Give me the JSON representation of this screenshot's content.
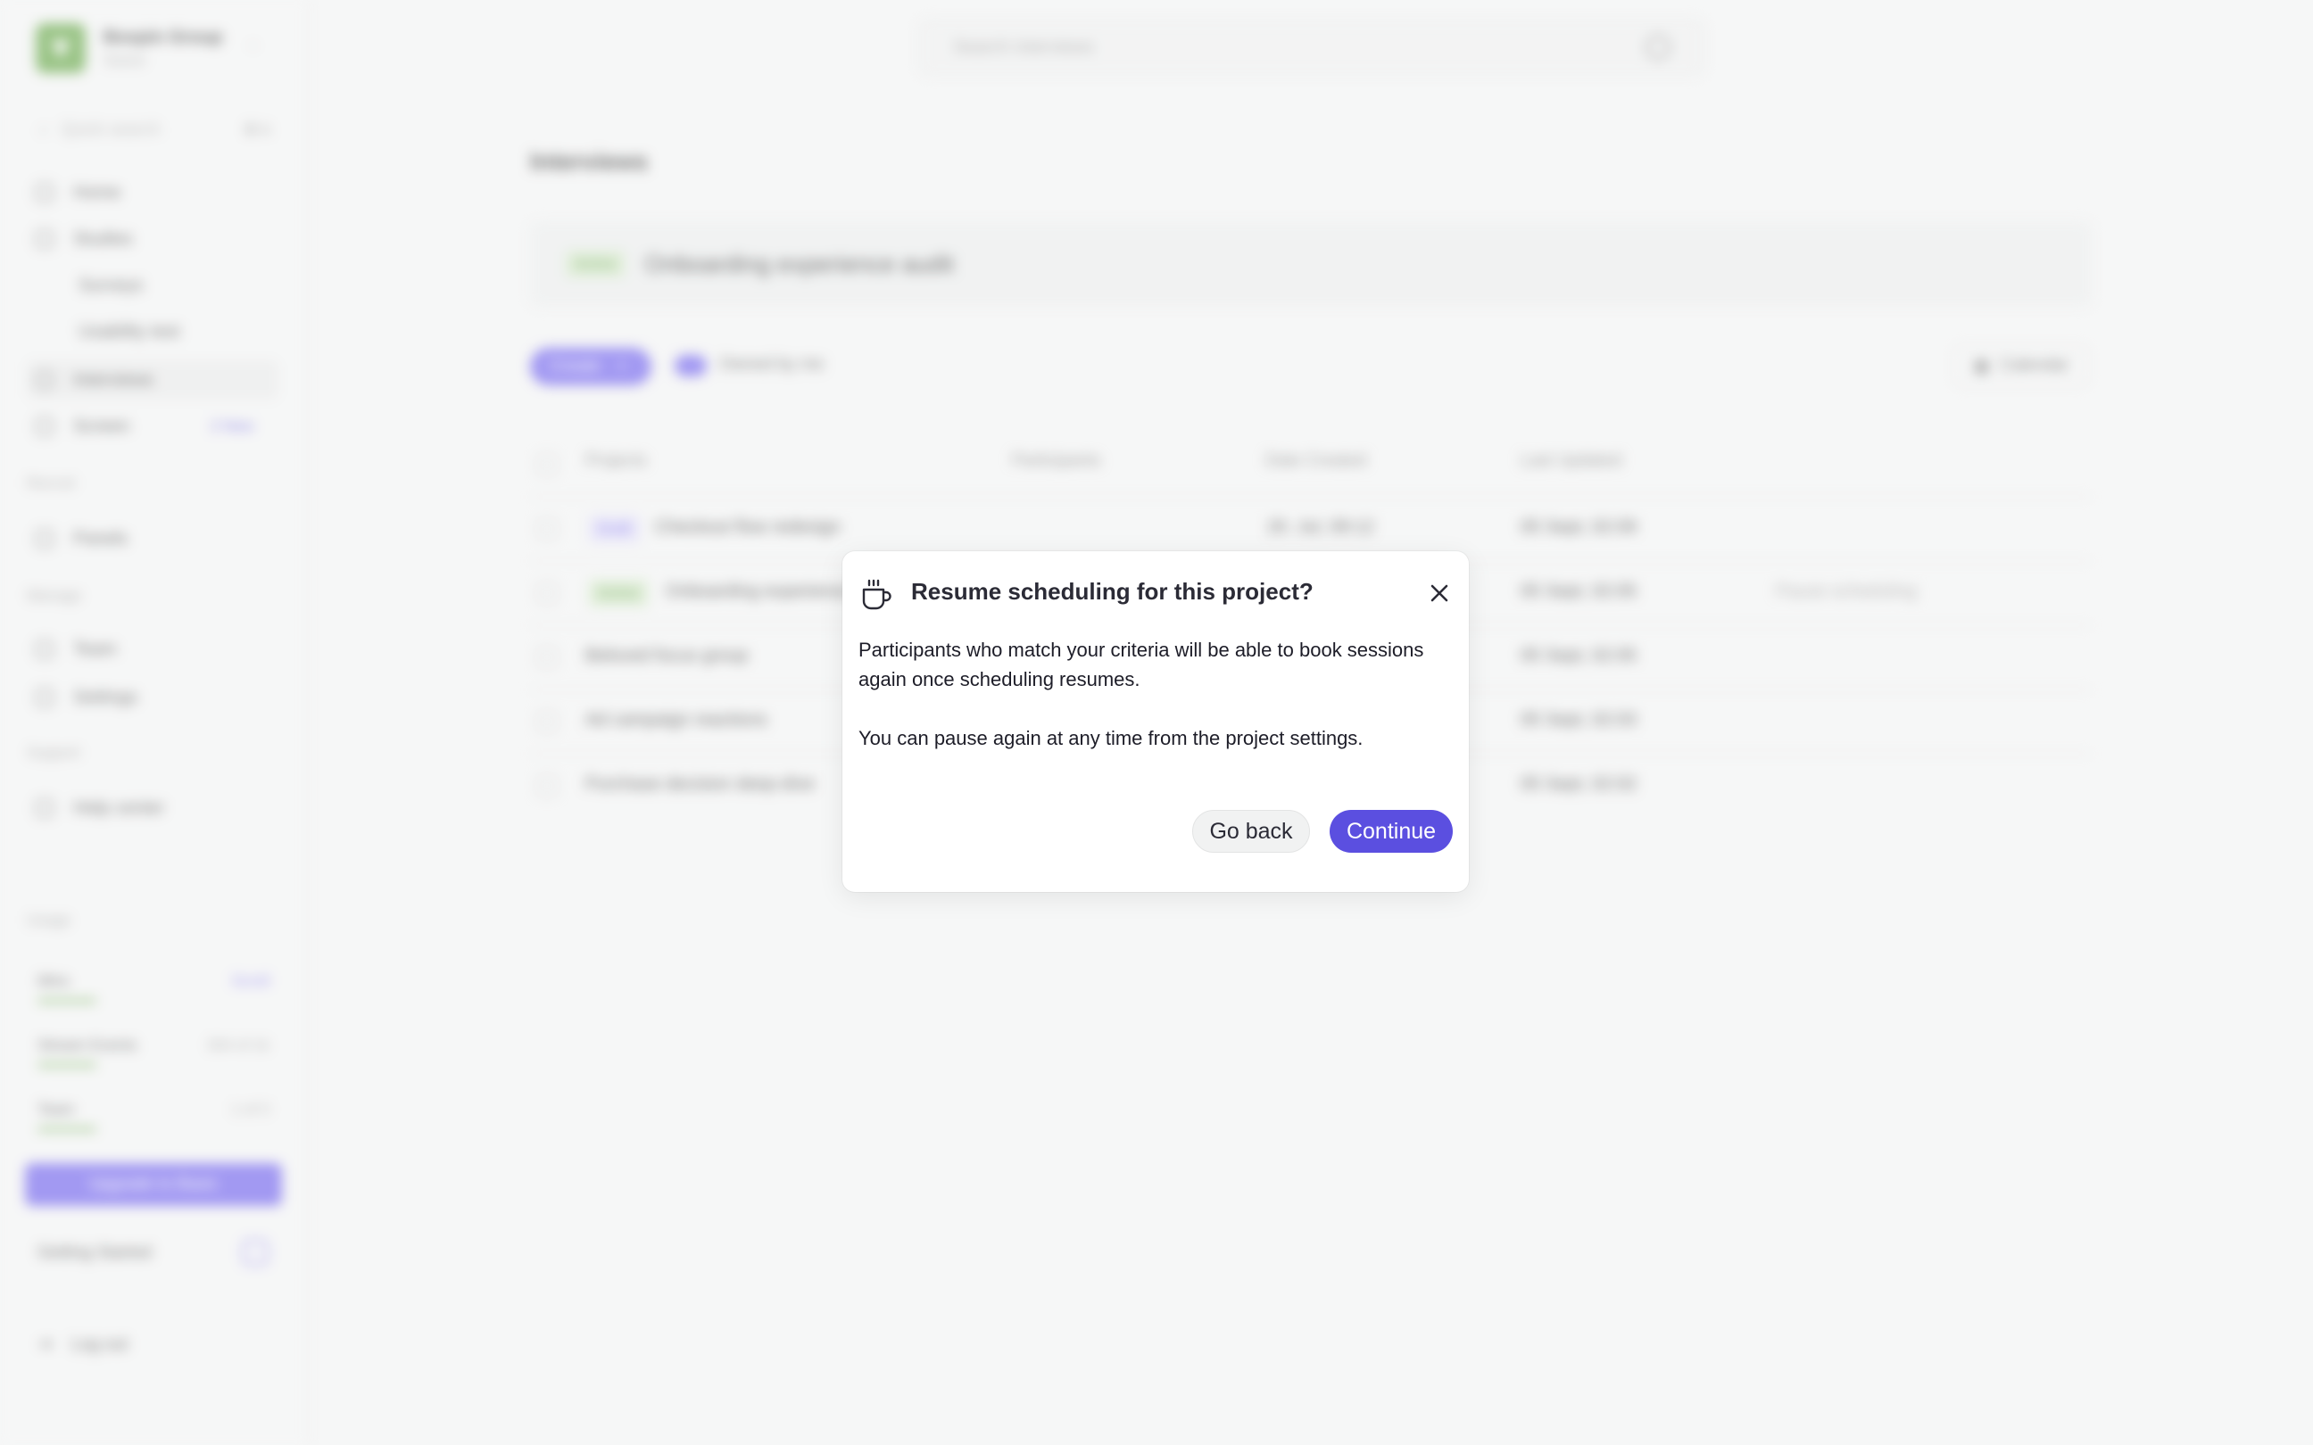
{
  "sidebar": {
    "org_name": "Boxpin Group",
    "org_plan": "Starter",
    "quick_search": "Quick search",
    "quick_shortcut": "⌘ K",
    "nav": [
      {
        "label": "Home"
      },
      {
        "label": "Studies"
      },
      {
        "label": "Surveys"
      },
      {
        "label": "Usability test"
      },
      {
        "label": "Interviews"
      },
      {
        "label": "Screen",
        "badge": "2 New"
      }
    ],
    "recruit_label": "Recruit",
    "panels_label": "Panels",
    "manage_label": "Manage",
    "team_label": "Team",
    "settings_label": "Settings",
    "support_label": "Support",
    "help_label": "Help center",
    "usage_label": "Usage",
    "usage": [
      {
        "name": "Mins",
        "value": "Scroll"
      },
      {
        "name": "Stream Events",
        "value": "304 of 1k"
      },
      {
        "name": "Team",
        "value": "1 of 3"
      }
    ],
    "upgrade_label": "Upgrade to Basic",
    "getting_started": "Getting Started",
    "logout": "Log out"
  },
  "header": {
    "search_placeholder": "Search interviews"
  },
  "main": {
    "title": "Interviews",
    "hero": {
      "status": "Active",
      "name": "Onboarding experience audit"
    },
    "create_label": "Create",
    "owned_label": "Owned by me",
    "calendar_label": "Calendar",
    "columns": [
      "Projects",
      "Participants",
      "Date Created",
      "Last Updated"
    ],
    "rows": [
      {
        "status": "Draft",
        "name": "Checkout flow redesign",
        "created": "20. Jul, 09:12",
        "updated": "05 Sept, 02:09"
      },
      {
        "status": "Active",
        "name": "Onboarding experience audit",
        "created": "",
        "updated": "05 Sept, 02:05",
        "note": "Pause scheduling"
      },
      {
        "status": "",
        "name": "Beloved focus group",
        "created": "",
        "updated": "05 Sept, 02:05"
      },
      {
        "status": "",
        "name": "Ad campaign reactions",
        "created": "",
        "updated": "05 Sept, 02:03"
      },
      {
        "status": "",
        "name": "Purchase decision deep-dive",
        "created": "",
        "updated": "05 Sept, 02:02"
      }
    ]
  },
  "dialog": {
    "icon": "coffee-cup-icon",
    "title": "Resume scheduling for this project?",
    "body_1": "Participants who match your criteria will be able to book sessions again once scheduling resumes.",
    "body_2": "You can pause again at any time from the project settings.",
    "back_label": "Go back",
    "continue_label": "Continue"
  },
  "colors": {
    "accent": "#5b4fe0",
    "active_green": "#4b8d2f"
  }
}
